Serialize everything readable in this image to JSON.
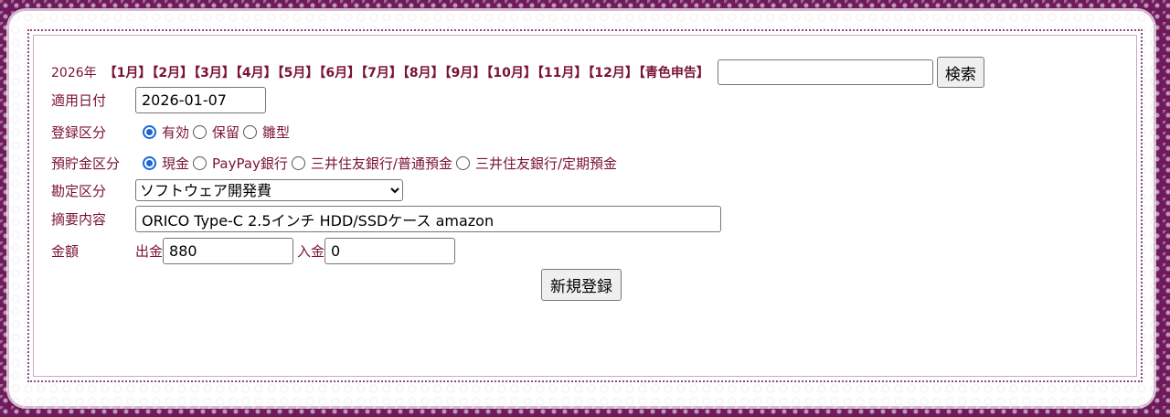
{
  "header": {
    "year": "2026年",
    "months": [
      "【1月】",
      "【2月】",
      "【3月】",
      "【4月】",
      "【5月】",
      "【6月】",
      "【7月】",
      "【8月】",
      "【9月】",
      "【10月】",
      "【11月】",
      "【12月】",
      "【青色申告】"
    ],
    "search_value": "",
    "search_button": "検索"
  },
  "form": {
    "date_label": "適用日付",
    "date_value": "2026-01-07",
    "status_label": "登録区分",
    "status_options": [
      "有効",
      "保留",
      "雛型"
    ],
    "account_label": "預貯金区分",
    "account_options": [
      "現金",
      "PayPay銀行",
      "三井住友銀行/普通預金",
      "三井住友銀行/定期預金"
    ],
    "category_label": "勘定区分",
    "category_value": "ソフトウェア開発費",
    "summary_label": "摘要内容",
    "summary_value": "ORICO Type-C 2.5インチ HDD/SSDケース amazon",
    "amount_label": "金額",
    "out_label": "出金",
    "out_value": "880",
    "in_label": "入金",
    "in_value": "0",
    "submit_label": "新規登録"
  },
  "colors": {
    "accent": "#7a1235",
    "background": "#6e1a5c",
    "radio_checked": "#1a66d6"
  }
}
